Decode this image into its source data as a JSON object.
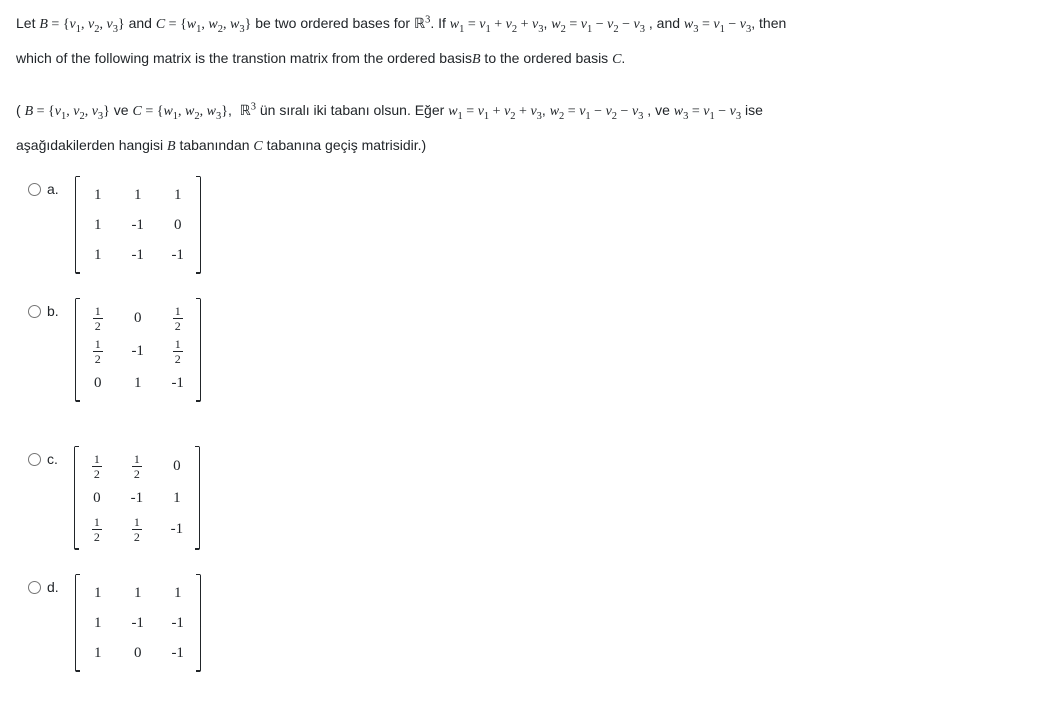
{
  "question": {
    "en_line1_prefix": "Let ",
    "B_def": "B = {v₁, v₂, v₃}",
    "and": " and ",
    "C_def": "C = {w₁, w₂, w₃}",
    "en_line1_mid": " be two ordered bases for ",
    "space": "ℝ³",
    "en_line1_if": ". If ",
    "w1": "w₁ = v₁ + v₂ + v₃",
    "w2": "w₂ = v₁ − v₂ − v₃",
    "en_and2": " , and ",
    "w3": "w₃ = v₁ − v₃",
    "en_then": ", then",
    "en_line2": "which of the following matrix is the transtion matrix from the ordered basisB to the ordered basis C.",
    "tr_line1_prefix": "( ",
    "tr_ve": " ve ",
    "tr_mid": ",  ℝ³ ün sıralı iki tabanı olsun. Eğer ",
    "tr_ve2": " , ve ",
    "tr_ise": " ise",
    "tr_line2": "aşağıdakilerden hangisi B tabanından C tabanına geçiş matrisidir.)"
  },
  "options": [
    {
      "label": "a.",
      "matrix": [
        [
          "1",
          "1",
          "1"
        ],
        [
          "1",
          "-1",
          "0"
        ],
        [
          "1",
          "-1",
          "-1"
        ]
      ]
    },
    {
      "label": "b.",
      "matrix": [
        [
          "1/2",
          "0",
          "1/2"
        ],
        [
          "1/2",
          "-1",
          "1/2"
        ],
        [
          "0",
          "1",
          "-1"
        ]
      ]
    },
    {
      "label": "c.",
      "matrix": [
        [
          "1/2",
          "1/2",
          "0"
        ],
        [
          "0",
          "-1",
          "1"
        ],
        [
          "1/2",
          "1/2",
          "-1"
        ]
      ]
    },
    {
      "label": "d.",
      "matrix": [
        [
          "1",
          "1",
          "1"
        ],
        [
          "1",
          "-1",
          "-1"
        ],
        [
          "1",
          "0",
          "-1"
        ]
      ]
    }
  ]
}
